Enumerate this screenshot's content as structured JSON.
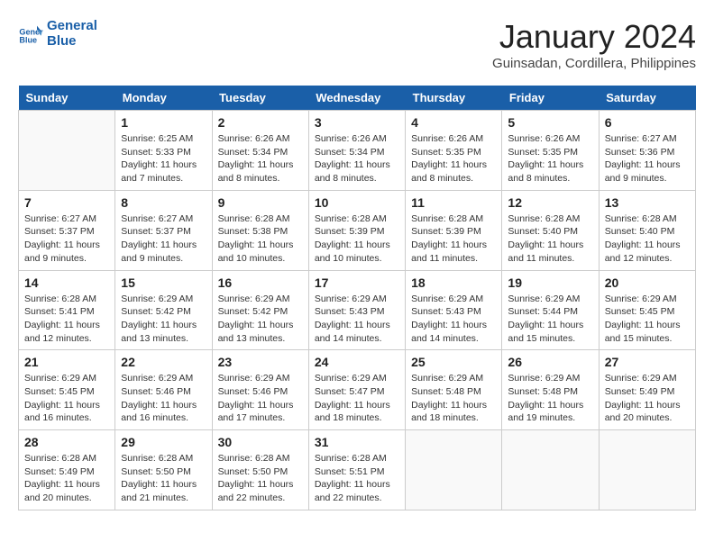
{
  "header": {
    "logo_line1": "General",
    "logo_line2": "Blue",
    "title": "January 2024",
    "subtitle": "Guinsadan, Cordillera, Philippines"
  },
  "days_of_week": [
    "Sunday",
    "Monday",
    "Tuesday",
    "Wednesday",
    "Thursday",
    "Friday",
    "Saturday"
  ],
  "weeks": [
    [
      {
        "day": "",
        "info": ""
      },
      {
        "day": "1",
        "info": "Sunrise: 6:25 AM\nSunset: 5:33 PM\nDaylight: 11 hours\nand 7 minutes."
      },
      {
        "day": "2",
        "info": "Sunrise: 6:26 AM\nSunset: 5:34 PM\nDaylight: 11 hours\nand 8 minutes."
      },
      {
        "day": "3",
        "info": "Sunrise: 6:26 AM\nSunset: 5:34 PM\nDaylight: 11 hours\nand 8 minutes."
      },
      {
        "day": "4",
        "info": "Sunrise: 6:26 AM\nSunset: 5:35 PM\nDaylight: 11 hours\nand 8 minutes."
      },
      {
        "day": "5",
        "info": "Sunrise: 6:26 AM\nSunset: 5:35 PM\nDaylight: 11 hours\nand 8 minutes."
      },
      {
        "day": "6",
        "info": "Sunrise: 6:27 AM\nSunset: 5:36 PM\nDaylight: 11 hours\nand 9 minutes."
      }
    ],
    [
      {
        "day": "7",
        "info": "Sunrise: 6:27 AM\nSunset: 5:37 PM\nDaylight: 11 hours\nand 9 minutes."
      },
      {
        "day": "8",
        "info": "Sunrise: 6:27 AM\nSunset: 5:37 PM\nDaylight: 11 hours\nand 9 minutes."
      },
      {
        "day": "9",
        "info": "Sunrise: 6:28 AM\nSunset: 5:38 PM\nDaylight: 11 hours\nand 10 minutes."
      },
      {
        "day": "10",
        "info": "Sunrise: 6:28 AM\nSunset: 5:39 PM\nDaylight: 11 hours\nand 10 minutes."
      },
      {
        "day": "11",
        "info": "Sunrise: 6:28 AM\nSunset: 5:39 PM\nDaylight: 11 hours\nand 11 minutes."
      },
      {
        "day": "12",
        "info": "Sunrise: 6:28 AM\nSunset: 5:40 PM\nDaylight: 11 hours\nand 11 minutes."
      },
      {
        "day": "13",
        "info": "Sunrise: 6:28 AM\nSunset: 5:40 PM\nDaylight: 11 hours\nand 12 minutes."
      }
    ],
    [
      {
        "day": "14",
        "info": "Sunrise: 6:28 AM\nSunset: 5:41 PM\nDaylight: 11 hours\nand 12 minutes."
      },
      {
        "day": "15",
        "info": "Sunrise: 6:29 AM\nSunset: 5:42 PM\nDaylight: 11 hours\nand 13 minutes."
      },
      {
        "day": "16",
        "info": "Sunrise: 6:29 AM\nSunset: 5:42 PM\nDaylight: 11 hours\nand 13 minutes."
      },
      {
        "day": "17",
        "info": "Sunrise: 6:29 AM\nSunset: 5:43 PM\nDaylight: 11 hours\nand 14 minutes."
      },
      {
        "day": "18",
        "info": "Sunrise: 6:29 AM\nSunset: 5:43 PM\nDaylight: 11 hours\nand 14 minutes."
      },
      {
        "day": "19",
        "info": "Sunrise: 6:29 AM\nSunset: 5:44 PM\nDaylight: 11 hours\nand 15 minutes."
      },
      {
        "day": "20",
        "info": "Sunrise: 6:29 AM\nSunset: 5:45 PM\nDaylight: 11 hours\nand 15 minutes."
      }
    ],
    [
      {
        "day": "21",
        "info": "Sunrise: 6:29 AM\nSunset: 5:45 PM\nDaylight: 11 hours\nand 16 minutes."
      },
      {
        "day": "22",
        "info": "Sunrise: 6:29 AM\nSunset: 5:46 PM\nDaylight: 11 hours\nand 16 minutes."
      },
      {
        "day": "23",
        "info": "Sunrise: 6:29 AM\nSunset: 5:46 PM\nDaylight: 11 hours\nand 17 minutes."
      },
      {
        "day": "24",
        "info": "Sunrise: 6:29 AM\nSunset: 5:47 PM\nDaylight: 11 hours\nand 18 minutes."
      },
      {
        "day": "25",
        "info": "Sunrise: 6:29 AM\nSunset: 5:48 PM\nDaylight: 11 hours\nand 18 minutes."
      },
      {
        "day": "26",
        "info": "Sunrise: 6:29 AM\nSunset: 5:48 PM\nDaylight: 11 hours\nand 19 minutes."
      },
      {
        "day": "27",
        "info": "Sunrise: 6:29 AM\nSunset: 5:49 PM\nDaylight: 11 hours\nand 20 minutes."
      }
    ],
    [
      {
        "day": "28",
        "info": "Sunrise: 6:28 AM\nSunset: 5:49 PM\nDaylight: 11 hours\nand 20 minutes."
      },
      {
        "day": "29",
        "info": "Sunrise: 6:28 AM\nSunset: 5:50 PM\nDaylight: 11 hours\nand 21 minutes."
      },
      {
        "day": "30",
        "info": "Sunrise: 6:28 AM\nSunset: 5:50 PM\nDaylight: 11 hours\nand 22 minutes."
      },
      {
        "day": "31",
        "info": "Sunrise: 6:28 AM\nSunset: 5:51 PM\nDaylight: 11 hours\nand 22 minutes."
      },
      {
        "day": "",
        "info": ""
      },
      {
        "day": "",
        "info": ""
      },
      {
        "day": "",
        "info": ""
      }
    ]
  ]
}
